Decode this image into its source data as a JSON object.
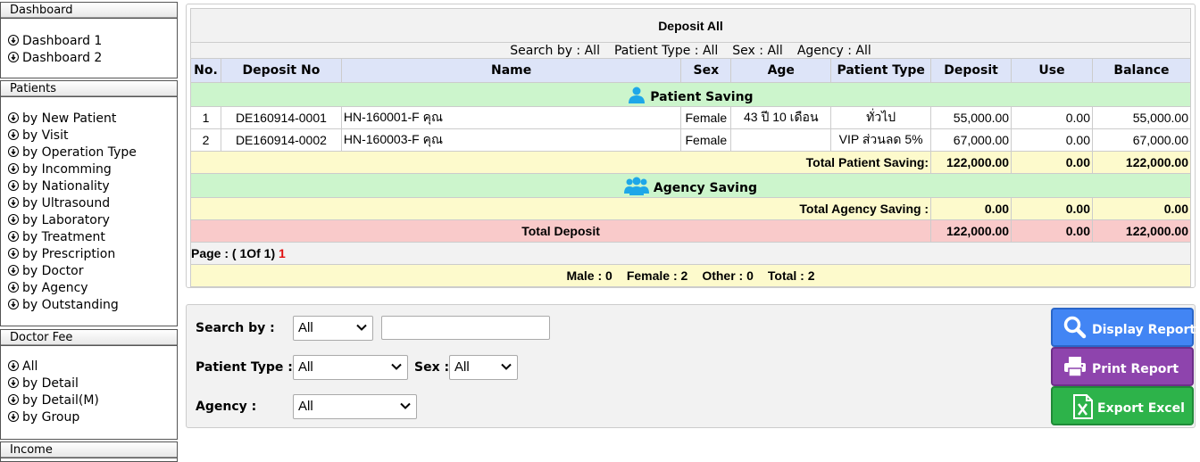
{
  "sidebar": {
    "sections": [
      {
        "title": "Dashboard",
        "items": [
          "Dashboard 1",
          "Dashboard 2"
        ]
      },
      {
        "title": "Patients",
        "items": [
          "by New Patient",
          "by Visit",
          "by Operation Type",
          "by Incomming",
          "by Nationality",
          "by Ultrasound",
          "by Laboratory",
          "by Treatment",
          "by Prescription",
          "by Doctor",
          "by Agency",
          "by Outstanding"
        ]
      },
      {
        "title": "Doctor Fee",
        "items": [
          "All",
          "by Detail",
          "by Detail(M)",
          "by Group"
        ]
      },
      {
        "title": "Income",
        "items": []
      }
    ]
  },
  "report": {
    "title": "Deposit All",
    "criteria": {
      "search_by": "Search by : All",
      "patient_type": "Patient Type : All",
      "sex": "Sex : All",
      "agency": "Agency : All"
    },
    "columns": [
      "No.",
      "Deposit No",
      "Name",
      "Sex",
      "Age",
      "Patient Type",
      "Deposit",
      "Use",
      "Balance"
    ],
    "patient_saving": {
      "label": "Patient Saving",
      "rows": [
        {
          "no": "1",
          "deposit_no": "DE160914-0001",
          "name": "HN-160001-F คุณ",
          "sex": "Female",
          "age": "43 ปี 10 เดือน",
          "patient_type": "ทั่วไป",
          "deposit": "55,000.00",
          "use": "0.00",
          "balance": "55,000.00"
        },
        {
          "no": "2",
          "deposit_no": "DE160914-0002",
          "name": "HN-160003-F คุณ",
          "sex": "Female",
          "age": "",
          "patient_type": "VIP ส่วนลด 5%",
          "deposit": "67,000.00",
          "use": "0.00",
          "balance": "67,000.00"
        }
      ],
      "total_label": "Total Patient Saving:",
      "total": {
        "deposit": "122,000.00",
        "use": "0.00",
        "balance": "122,000.00"
      }
    },
    "agency_saving": {
      "label": "Agency Saving",
      "total_label": "Total Agency Saving :",
      "total": {
        "deposit": "0.00",
        "use": "0.00",
        "balance": "0.00"
      }
    },
    "total_deposit": {
      "label": "Total Deposit",
      "deposit": "122,000.00",
      "use": "0.00",
      "balance": "122,000.00"
    },
    "page": {
      "label": "Page : ( 1Of 1)",
      "current": "1"
    },
    "summary": {
      "male": "Male : 0",
      "female": "Female : 2",
      "other": "Other : 0",
      "total": "Total : 2"
    }
  },
  "search_panel": {
    "search_by": {
      "label": "Search by :",
      "value": "All",
      "text": ""
    },
    "patient_type": {
      "label": "Patient Type :",
      "value": "All"
    },
    "sex": {
      "label": "Sex :",
      "value": "All"
    },
    "agency": {
      "label": "Agency :",
      "value": "All"
    },
    "buttons": {
      "display": "Display Report",
      "print": "Print Report",
      "excel": "Export Excel"
    }
  },
  "colors": {
    "header_blue": "#dde4f8",
    "group_green": "#ccf5cc",
    "subtotal_yellow": "#fdfacc",
    "total_pink": "#f9caca",
    "btn_display": "#4285f4",
    "btn_print": "#8e44ad",
    "btn_excel": "#2db34a",
    "icon_cyan": "#1ea7e8"
  }
}
